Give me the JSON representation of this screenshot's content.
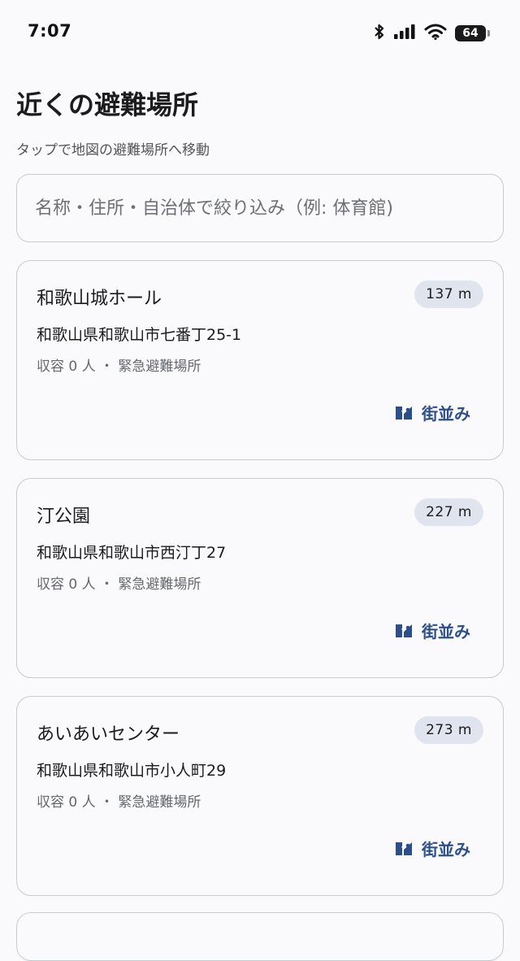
{
  "status_bar": {
    "time": "7:07",
    "battery": "64"
  },
  "header": {
    "title": "近くの避難場所",
    "subtitle": "タップで地図の避難場所へ移動"
  },
  "search": {
    "placeholder": "名称・住所・自治体で絞り込み（例: 体育館)"
  },
  "shelters": [
    {
      "name": "和歌山城ホール",
      "distance": "137 m",
      "address": "和歌山県和歌山市七番丁25-1",
      "meta": "収容 0 人 ・ 緊急避難場所",
      "action_label": "街並み"
    },
    {
      "name": "汀公園",
      "distance": "227 m",
      "address": "和歌山県和歌山市西汀丁27",
      "meta": "収容 0 人 ・ 緊急避難場所",
      "action_label": "街並み"
    },
    {
      "name": "あいあいセンター",
      "distance": "273 m",
      "address": "和歌山県和歌山市小人町29",
      "meta": "収容 0 人 ・ 緊急避難場所",
      "action_label": "街並み"
    }
  ],
  "colors": {
    "accent": "#2c4f8c",
    "badge_bg": "#e0e4ee",
    "border": "#c7cbd2"
  }
}
